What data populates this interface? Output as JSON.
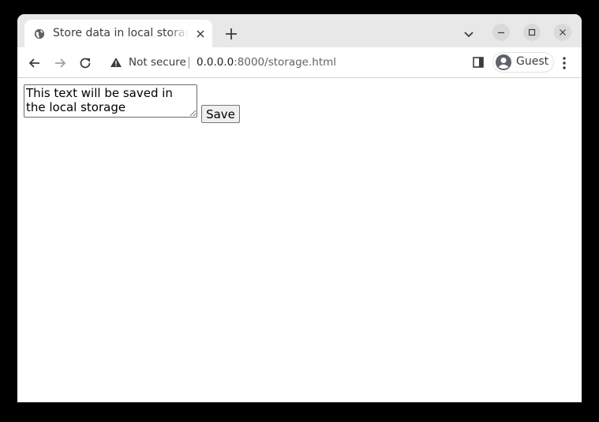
{
  "tab": {
    "title": "Store data in local storage",
    "favicon": "globe-icon"
  },
  "toolbar": {
    "security_label": "Not secure",
    "url_host": "0.0.0.0",
    "url_path": ":8000/storage.html",
    "profile_label": "Guest"
  },
  "page": {
    "textarea_value": "This text will be saved in the local storage",
    "save_label": "Save"
  },
  "colors": {
    "tabstrip_bg": "#e8e8e8",
    "window_button_bg": "#d9d9d9"
  }
}
